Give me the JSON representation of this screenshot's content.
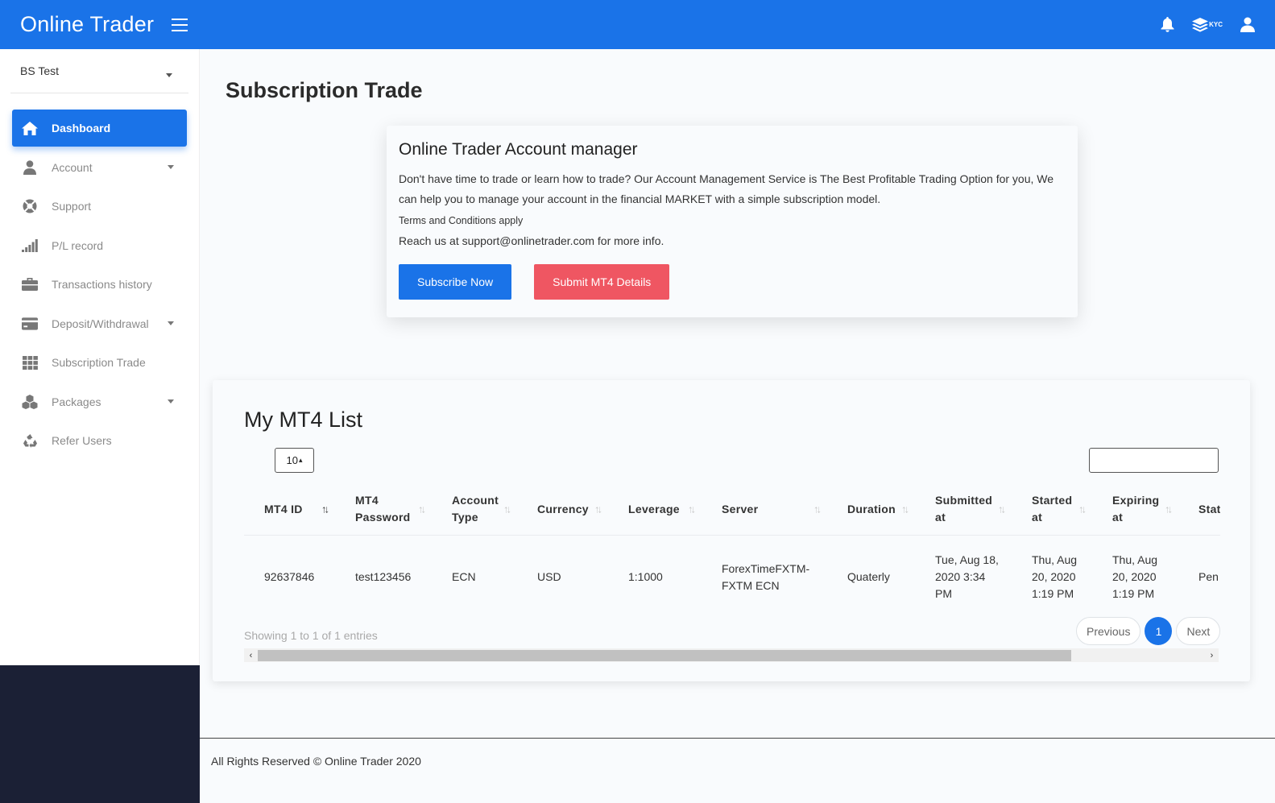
{
  "header": {
    "brand": "Online Trader",
    "kyc_label": "KYC"
  },
  "sidebar": {
    "user": "BS Test",
    "items": [
      {
        "label": "Dashboard",
        "icon": "home-icon"
      },
      {
        "label": "Account",
        "icon": "user-icon"
      },
      {
        "label": "Support",
        "icon": "lifebuoy-icon"
      },
      {
        "label": "P/L record",
        "icon": "signal-bars-icon"
      },
      {
        "label": "Transactions history",
        "icon": "briefcase-icon"
      },
      {
        "label": "Deposit/Withdrawal",
        "icon": "credit-card-icon"
      },
      {
        "label": "Subscription Trade",
        "icon": "grid-icon"
      },
      {
        "label": "Packages",
        "icon": "cubes-icon"
      },
      {
        "label": "Refer Users",
        "icon": "recycle-icon"
      }
    ]
  },
  "page": {
    "title": "Subscription Trade"
  },
  "manager": {
    "title": "Online Trader Account manager",
    "text": "Don't have time to trade or learn how to trade? Our Account Management Service is The Best Profitable Trading Option for you, We can help you to manage your account in the financial MARKET with a simple subscription model.",
    "terms": "Terms and Conditions apply",
    "contact": "Reach us at support@onlinetrader.com for more info.",
    "subscribe_label": "Subscribe Now",
    "submit_label": "Submit MT4 Details"
  },
  "mt4": {
    "title": "My MT4 List",
    "page_length": "10",
    "columns": [
      "MT4 ID",
      "MT4 Password",
      "Account Type",
      "Currency",
      "Leverage",
      "Server",
      "Duration",
      "Submitted at",
      "Started at",
      "Expiring at",
      "Stat"
    ],
    "rows": [
      [
        "92637846",
        "test123456",
        "ECN",
        "USD",
        "1:1000",
        "ForexTimeFXTM-FXTM ECN",
        "Quaterly",
        "Tue, Aug 18, 2020 3:34 PM",
        "Thu, Aug 20, 2020 1:19 PM",
        "Thu, Aug 20, 2020 1:19 PM",
        "Pen"
      ]
    ],
    "info": "Showing 1 to 1 of 1 entries",
    "prev_label": "Previous",
    "current_page": "1",
    "next_label": "Next"
  },
  "footer": {
    "text": "All Rights Reserved © Online Trader 2020"
  },
  "colors": {
    "primary": "#1a73e8",
    "danger": "#ef5662",
    "sidebar_dark": "#1b2035"
  }
}
